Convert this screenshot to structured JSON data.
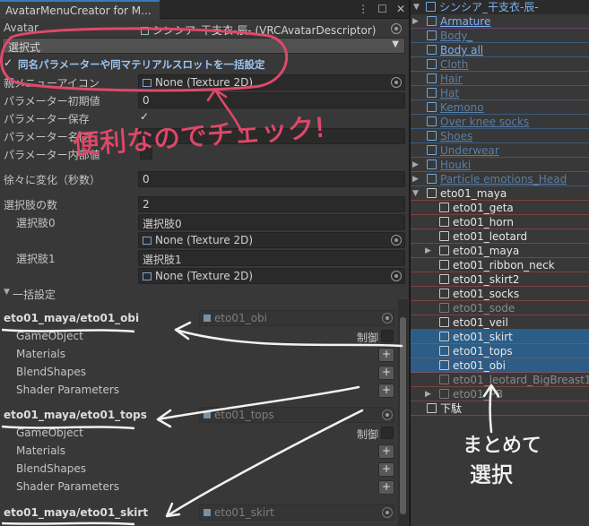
{
  "inspector": {
    "tab_title": "AvatarMenuCreator for M...",
    "tab_menu_glyph": "⋮",
    "tab_max_glyph": "☐",
    "tab_close_glyph": "✕",
    "avatar_label": "Avatar",
    "avatar_value": "シンシア_干支衣-辰- (VRCAvatarDescriptor)",
    "mode_value": "選択式",
    "bulk_toggle_label": "同名パラメーターや同マテリアルスロットを一括設定",
    "bulk_toggle_checked": "✓",
    "fields": [
      {
        "label": "親メニューアイコン",
        "value": "None (Texture 2D)"
      },
      {
        "label": "パラメーター初期値",
        "value": "0"
      },
      {
        "label": "パラメーター保存",
        "value": "✓"
      },
      {
        "label": "パラメーター名(オ",
        "value": ""
      },
      {
        "label": "パラメーター内部値",
        "value": ""
      }
    ],
    "fade_label": "徐々に変化（秒数）",
    "fade_value": "0",
    "choice_count_label": "選択肢の数",
    "choice_count_value": "2",
    "choices": [
      {
        "label": "選択肢0",
        "name": "選択肢0",
        "icon": "None (Texture 2D)"
      },
      {
        "label": "選択肢1",
        "name": "選択肢1",
        "icon": "None (Texture 2D)"
      }
    ],
    "bulk_section_label": "一括設定",
    "control_label": "制御",
    "sections": [
      {
        "title": "eto01_maya/eto01_obi",
        "object": "eto01_obi",
        "items": [
          "GameObject",
          "Materials",
          "BlendShapes",
          "Shader Parameters"
        ]
      },
      {
        "title": "eto01_maya/eto01_tops",
        "object": "eto01_tops",
        "items": [
          "GameObject",
          "Materials",
          "BlendShapes",
          "Shader Parameters"
        ]
      },
      {
        "title": "eto01_maya/eto01_skirt",
        "object": "eto01_skirt",
        "items": []
      }
    ],
    "plus_glyph": "+"
  },
  "hierarchy": {
    "root": "シンシア_干支衣-辰-",
    "rows": [
      {
        "text": "Armature",
        "style": "prefab",
        "indent": 1,
        "arrow": "▶"
      },
      {
        "text": "Body_",
        "style": "prefab dim",
        "indent": 1,
        "arrow": ""
      },
      {
        "text": "Body all",
        "style": "prefab",
        "indent": 1,
        "arrow": ""
      },
      {
        "text": "Cloth",
        "style": "prefab dim",
        "indent": 1,
        "arrow": ""
      },
      {
        "text": "Hair",
        "style": "prefab dim",
        "indent": 1,
        "arrow": ""
      },
      {
        "text": "Hat",
        "style": "prefab dim",
        "indent": 1,
        "arrow": ""
      },
      {
        "text": "Kemono",
        "style": "prefab dim",
        "indent": 1,
        "arrow": ""
      },
      {
        "text": "Over knee socks",
        "style": "prefab dim",
        "indent": 1,
        "arrow": ""
      },
      {
        "text": "Shoes",
        "style": "prefab dim",
        "indent": 1,
        "arrow": ""
      },
      {
        "text": "Underwear",
        "style": "prefab dim",
        "indent": 1,
        "arrow": ""
      },
      {
        "text": "Houki",
        "style": "prefab dim",
        "indent": 1,
        "arrow": "▶"
      },
      {
        "text": "Particle emotions_Head",
        "style": "prefab dim",
        "indent": 1,
        "arrow": "▶"
      },
      {
        "text": "eto01_maya",
        "style": "white",
        "indent": 1,
        "arrow": "▼"
      },
      {
        "text": "eto01_geta",
        "style": "white",
        "indent": 2,
        "arrow": ""
      },
      {
        "text": "eto01_horn",
        "style": "white",
        "indent": 2,
        "arrow": ""
      },
      {
        "text": "eto01_leotard",
        "style": "white",
        "indent": 2,
        "arrow": ""
      },
      {
        "text": "eto01_maya",
        "style": "white",
        "indent": 2,
        "arrow": "▶"
      },
      {
        "text": "eto01_ribbon_neck",
        "style": "white",
        "indent": 2,
        "arrow": ""
      },
      {
        "text": "eto01_skirt2",
        "style": "white",
        "indent": 2,
        "arrow": ""
      },
      {
        "text": "eto01_socks",
        "style": "white",
        "indent": 2,
        "arrow": ""
      },
      {
        "text": "eto01_sode",
        "style": "grey",
        "indent": 2,
        "arrow": ""
      },
      {
        "text": "eto01_veil",
        "style": "white",
        "indent": 2,
        "arrow": ""
      },
      {
        "text": "eto01_skirt",
        "style": "white",
        "indent": 2,
        "arrow": "",
        "selected": true
      },
      {
        "text": "eto01_tops",
        "style": "white",
        "indent": 2,
        "arrow": "",
        "selected": true
      },
      {
        "text": "eto01_obi",
        "style": "white",
        "indent": 2,
        "arrow": "",
        "selected": true
      },
      {
        "text": "eto01_leotard_BigBreast1",
        "style": "grey",
        "indent": 2,
        "arrow": ""
      },
      {
        "text": "eto01_PB",
        "style": "grey",
        "indent": 2,
        "arrow": "▶"
      },
      {
        "text": "下駄",
        "style": "white",
        "indent": 1,
        "arrow": ""
      }
    ]
  },
  "annotations": {
    "note_convenient": "便利なのでチェック!",
    "note_select_together_1": "まとめて",
    "note_select_together_2": "選択"
  },
  "colors": {
    "annotation_red": "#e0486a",
    "annotation_white": "#f2f2f2",
    "selection": "#2c5d87",
    "prefab_blue": "#7fb3ef"
  }
}
